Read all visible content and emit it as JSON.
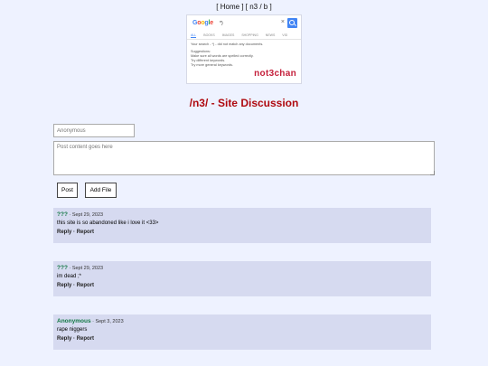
{
  "nav": {
    "open": "[",
    "home": "Home",
    "mid": "] [",
    "board": "n3 / b",
    "close": "]"
  },
  "banner": {
    "logo": [
      "G",
      "o",
      "o",
      "g",
      "l",
      "e"
    ],
    "query": "*)",
    "close_glyph": "×",
    "tabs": [
      "ALL",
      "BOOKS",
      "IMAGES",
      "SHOPPING",
      "NEWS",
      "VID"
    ],
    "message": "Your search - *) - did not match any documents.",
    "suggestions_title": "Suggestions:",
    "suggestions": [
      "Make sure all words are spelled correctly.",
      "Try different keywords.",
      "Try more general keywords."
    ],
    "wordmark": "not3chan"
  },
  "page": {
    "title": "/n3/ - Site Discussion"
  },
  "form": {
    "name_placeholder": "Anonymous",
    "content_placeholder": "Post content goes here",
    "post_label": "Post",
    "file_label": "Add File"
  },
  "posts": [
    {
      "name": "???",
      "sep": " · ",
      "date": "Sept 29, 2023",
      "text": "this site is so abandoned like i love it <33>",
      "reply": "Reply",
      "dot": " · ",
      "report": "Report"
    },
    {
      "name": "???",
      "sep": " · ",
      "date": "Sept 29, 2023",
      "text": "im dead ;*",
      "reply": "Reply",
      "dot": " · ",
      "report": "Report"
    },
    {
      "name": "Anonymous",
      "sep": " · ",
      "date": "Sept 3, 2023",
      "text": "rape niggers",
      "reply": "Reply",
      "dot": " · ",
      "report": "Report"
    }
  ],
  "colors": {
    "background": "#eef2ff",
    "post_bg": "#d6daf0",
    "title": "#af0a0f",
    "name": "#117743",
    "wordmark": "#c41e3a",
    "search_button": "#4285f4"
  }
}
